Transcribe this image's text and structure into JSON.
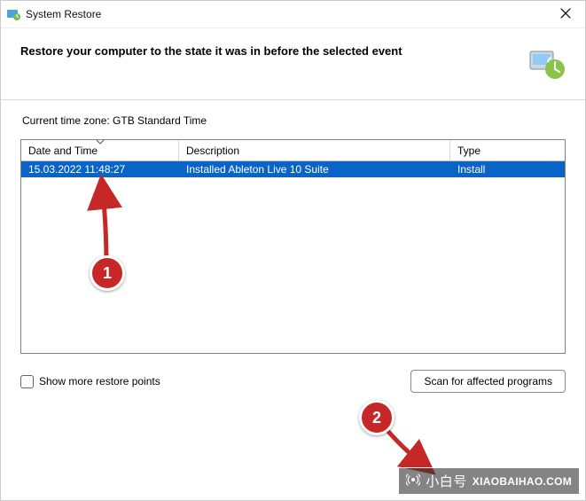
{
  "window": {
    "title": "System Restore",
    "heading": "Restore your computer to the state it was in before the selected event"
  },
  "timezone_label": "Current time zone: GTB Standard Time",
  "table": {
    "columns": {
      "date_time": "Date and Time",
      "description": "Description",
      "type": "Type"
    },
    "rows": [
      {
        "date_time": "15.03.2022 11:48:27",
        "description": "Installed Ableton Live 10 Suite",
        "type": "Install",
        "selected": true
      }
    ]
  },
  "controls": {
    "show_more_label": "Show more restore points",
    "show_more_checked": false,
    "scan_button_label": "Scan for affected programs"
  },
  "annotations": {
    "badge1": "1",
    "badge2": "2"
  },
  "watermark": {
    "brand_cn": "小白号",
    "domain": "XIAOBAIHAO.COM"
  }
}
